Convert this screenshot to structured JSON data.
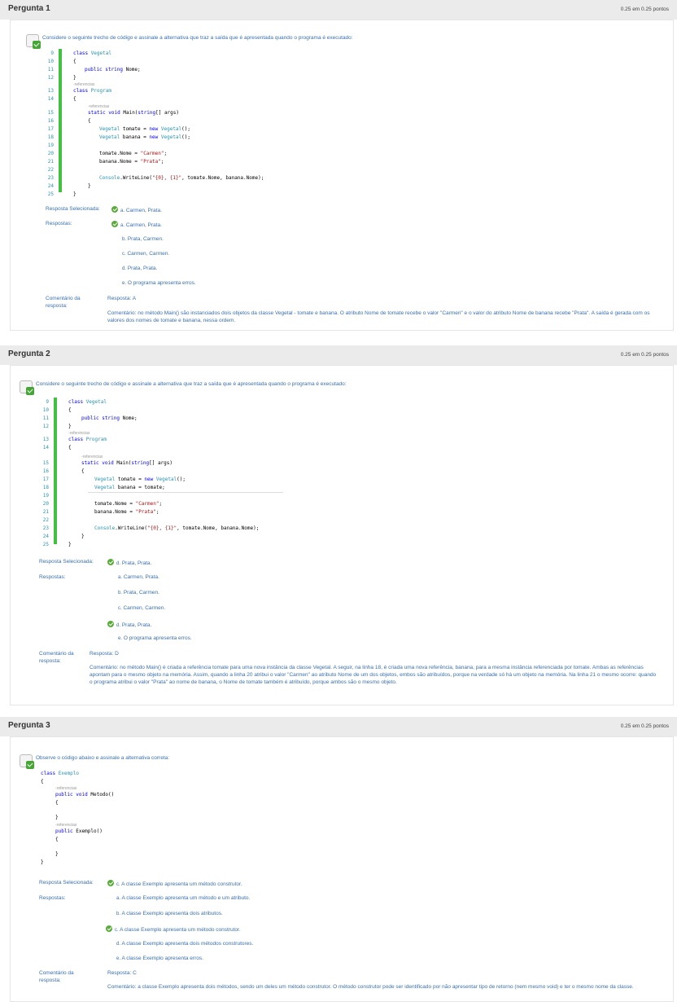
{
  "questions": [
    {
      "title": "Pergunta 1",
      "score": "0.25 em 0.25 pontos",
      "prompt": "Considere o seguinte trecho de código e assinale a alternativa que traz a saída que é apresentada quando o programa é executado:",
      "selected_label": "Resposta Selecionada:",
      "selected": {
        "letter": "a.",
        "text": "Carmen, Prata."
      },
      "answers_label": "Respostas:",
      "answers": [
        {
          "letter": "a.",
          "text": "Carmen, Prata.",
          "correct": true
        },
        {
          "letter": "b.",
          "text": "Prata, Carmen.",
          "correct": false
        },
        {
          "letter": "c.",
          "text": "Carmen, Carmen.",
          "correct": false
        },
        {
          "letter": "d.",
          "text": "Prata, Prata.",
          "correct": false
        },
        {
          "letter": "e.",
          "text": "O programa apresenta erros.",
          "correct": false
        }
      ],
      "comment_label": "Comentário da resposta:",
      "comment_answer": "Resposta: A",
      "comment_text": "Comentário: no método Main() são instanciados dois objetos da classe Vegetal - tomate e banana. O atributo Nome de tomate recebe o valor \"Carmen\" e o valor do atributo Nome de banana recebe \"Prata\". A saída é gerada com os valores dos nomes de tomate e banana, nessa ordem."
    },
    {
      "title": "Pergunta 2",
      "score": "0.25 em 0.25 pontos",
      "prompt": "Considere o seguinte trecho de código e assinale a alternativa que traz a saída que é apresentada quando o programa é executado:",
      "selected_label": "Resposta Selecionada:",
      "selected": {
        "letter": "d.",
        "text": "Prata, Prata."
      },
      "answers_label": "Respostas:",
      "answers": [
        {
          "letter": "a.",
          "text": "Carmen, Prata.",
          "correct": false
        },
        {
          "letter": "b.",
          "text": "Prata, Carmen.",
          "correct": false
        },
        {
          "letter": "c.",
          "text": "Carmen, Carmen.",
          "correct": false
        },
        {
          "letter": "d.",
          "text": "Prata, Prata.",
          "correct": true
        },
        {
          "letter": "e.",
          "text": "O programa apresenta erros.",
          "correct": false
        }
      ],
      "comment_label": "Comentário da resposta:",
      "comment_answer": "Resposta: D",
      "comment_text": "Comentário: no método Main() é criada a referência tomate para uma nova instância da classe Vegetal. A seguir, na linha 18, é criada uma nova referência, banana, para a mesma instância referenciada por tomate. Ambas as referências apontam para o mesmo objeto na memória. Assim, quando a linha 20 atribui o valor \"Carmen\" ao atributo Nome de um dos objetos, embos são atribuídos, porque na verdade só há um objeto na memória. Na linha 21 o mesmo ocorre: quando o programa atribui o valor \"Prata\" ao nome de banana, o Nome de tomate também é atribuído, porque ambos são o mesmo objeto."
    },
    {
      "title": "Pergunta 3",
      "score": "0.25 em 0.25 pontos",
      "prompt": "Observe o código abaixo e assinale a alternativa correta:",
      "selected_label": "Resposta Selecionada:",
      "selected": {
        "letter": "c.",
        "text": "A classe Exemplo apresenta um método construtor."
      },
      "answers_label": "Respostas:",
      "answers": [
        {
          "letter": "a.",
          "text": "A classe Exemplo apresenta um método e um atributo.",
          "correct": false
        },
        {
          "letter": "b.",
          "text": "A classe Exemplo apresenta dois atributos.",
          "correct": false
        },
        {
          "letter": "c.",
          "text": "A classe Exemplo apresenta um método construtor.",
          "correct": true
        },
        {
          "letter": "d.",
          "text": "A classe Exemplo apresenta dois métodos construtores.",
          "correct": false
        },
        {
          "letter": "e.",
          "text": "A classe Exemplo apresenta erros.",
          "correct": false
        }
      ],
      "comment_label": "Comentário da resposta:",
      "comment_answer": "Resposta: C",
      "comment_text": "Comentário: a classe Exemplo apresenta dois métodos, sendo um deles um método construtor. O método construtor pode ser identificado por não apresentar tipo de retorno (nem mesmo void) e ter o mesmo nome da classe."
    }
  ],
  "code1": {
    "line_numbers": [
      "9",
      "10",
      "11",
      "12",
      "13",
      "14",
      "15",
      "16",
      "17",
      "18",
      "19",
      "20",
      "21",
      "22",
      "23",
      "24",
      "25"
    ],
    "ref_label": "-referencias",
    "lines": {
      "l9a": "class ",
      "l9b": "Vegetal",
      "l10": "{",
      "l11a": "public string ",
      "l11b": "Nome;",
      "l12": "}",
      "l13a": "class ",
      "l13b": "Program",
      "l14": "{",
      "l15a": "static void ",
      "l15b": "Main(",
      "l15c": "string",
      "l15d": "[] args)",
      "l16": "{",
      "l17a": "Vegetal",
      "l17b": " tomate = ",
      "l17c": "new ",
      "l17d": "Vegetal",
      "l17e": "();",
      "l18a": "Vegetal",
      "l18b": " banana = ",
      "l18c": "new ",
      "l18d": "Vegetal",
      "l18e": "();",
      "l20a": "tomate.Nome = ",
      "l20b": "\"Carmen\"",
      "l20c": ";",
      "l21a": "banana.Nome = ",
      "l21b": "\"Prata\"",
      "l21c": ";",
      "l23a": "Console",
      "l23b": ".WriteLine(",
      "l23c": "\"{0}, {1}\"",
      "l23d": ", tomate.Nome, banana.Nome);",
      "l24": "}",
      "l25": "}"
    }
  },
  "code2": {
    "lines": {
      "l18a": "Vegetal",
      "l18b": " banana = tomate;"
    }
  },
  "code3": {
    "ref_label": "-referencias",
    "lines": {
      "c1a": "class ",
      "c1b": "Exemplo",
      "c2": "{",
      "c3a": "public void ",
      "c3b": "Metodo()",
      "c4": "{",
      "c5": "}",
      "c6a": "public ",
      "c6b": "Exemplo()",
      "c7": "{",
      "c8": "}",
      "c9": "}"
    }
  },
  "colors": {
    "accent": "#3a6fb0",
    "check_green": "#5aaa3c",
    "code_bar": "#41c041",
    "keyword": "#0000ff",
    "type": "#2b91af",
    "string": "#a31515"
  }
}
